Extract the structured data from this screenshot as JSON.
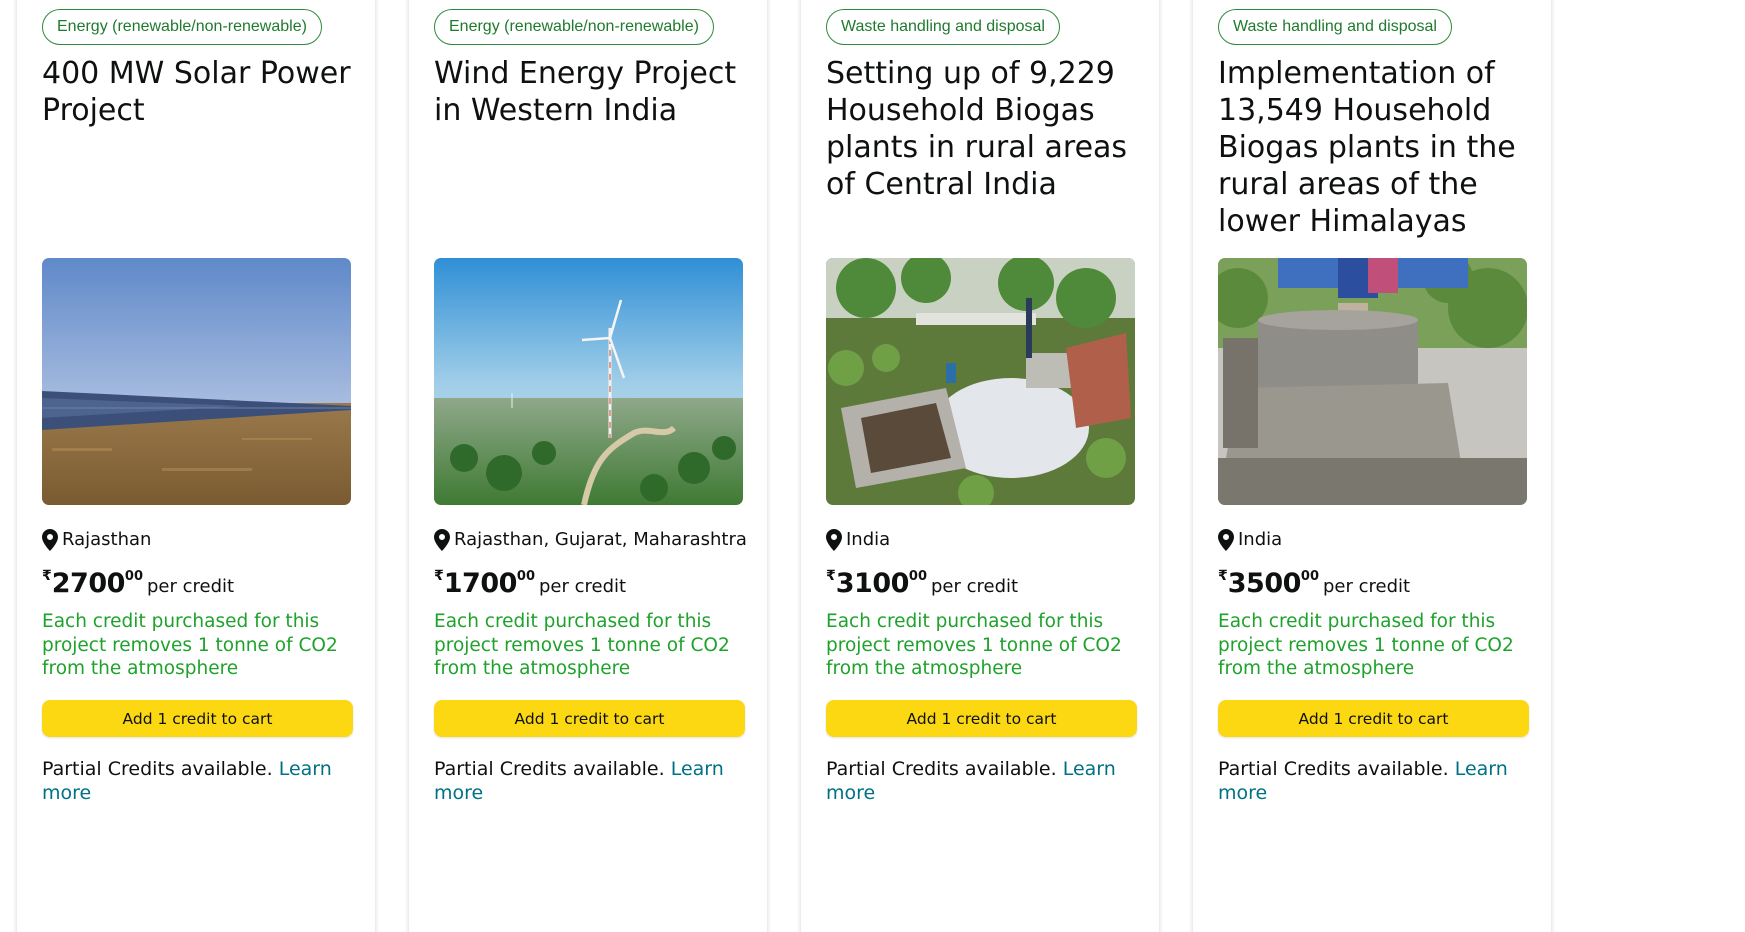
{
  "cards": [
    {
      "category": "Energy (renewable/non-renewable)",
      "title": "400 MW Solar Power Project",
      "location": "Rajasthan",
      "currency_symbol": "₹",
      "price_whole": "2700",
      "price_fraction": "00",
      "price_unit": "per credit",
      "impact": "Each credit purchased for this project removes 1 tonne of CO2 from the atmosphere",
      "cart_label": "Add 1 credit to cart",
      "partial_text": "Partial Credits available.",
      "learn_more": "Learn more",
      "image_icon": "solar-farm-photo"
    },
    {
      "category": "Energy (renewable/non-renewable)",
      "title": "Wind Energy Project in Western India",
      "location": "Rajasthan, Gujarat, Maharashtra",
      "currency_symbol": "₹",
      "price_whole": "1700",
      "price_fraction": "00",
      "price_unit": "per credit",
      "impact": "Each credit purchased for this project removes 1 tonne of CO2 from the atmosphere",
      "cart_label": "Add 1 credit to cart",
      "partial_text": "Partial Credits available.",
      "learn_more": "Learn more",
      "image_icon": "wind-turbine-photo"
    },
    {
      "category": "Waste handling and disposal",
      "title": "Setting up of 9,229 Household Biogas plants in rural areas of Central India",
      "location": "India",
      "currency_symbol": "₹",
      "price_whole": "3100",
      "price_fraction": "00",
      "price_unit": "per credit",
      "impact": "Each credit purchased for this project removes 1 tonne of CO2 from the atmosphere",
      "cart_label": "Add 1 credit to cart",
      "partial_text": "Partial Credits available.",
      "learn_more": "Learn more",
      "image_icon": "biogas-plant-photo"
    },
    {
      "category": "Waste handling and disposal",
      "title": "Implementation of 13,549 Household Biogas plants in the rural areas of the lower Himalayas",
      "location": "India",
      "currency_symbol": "₹",
      "price_whole": "3500",
      "price_fraction": "00",
      "price_unit": "per credit",
      "impact": "Each credit purchased for this project removes 1 tonne of CO2 from the atmosphere",
      "cart_label": "Add 1 credit to cart",
      "partial_text": "Partial Credits available.",
      "learn_more": "Learn more",
      "image_icon": "biogas-dome-photo"
    }
  ],
  "colors": {
    "tag_green": "#1f7a2e",
    "impact_green": "#1fa22c",
    "cart_yellow": "#fcd813",
    "link_teal": "#007185"
  }
}
